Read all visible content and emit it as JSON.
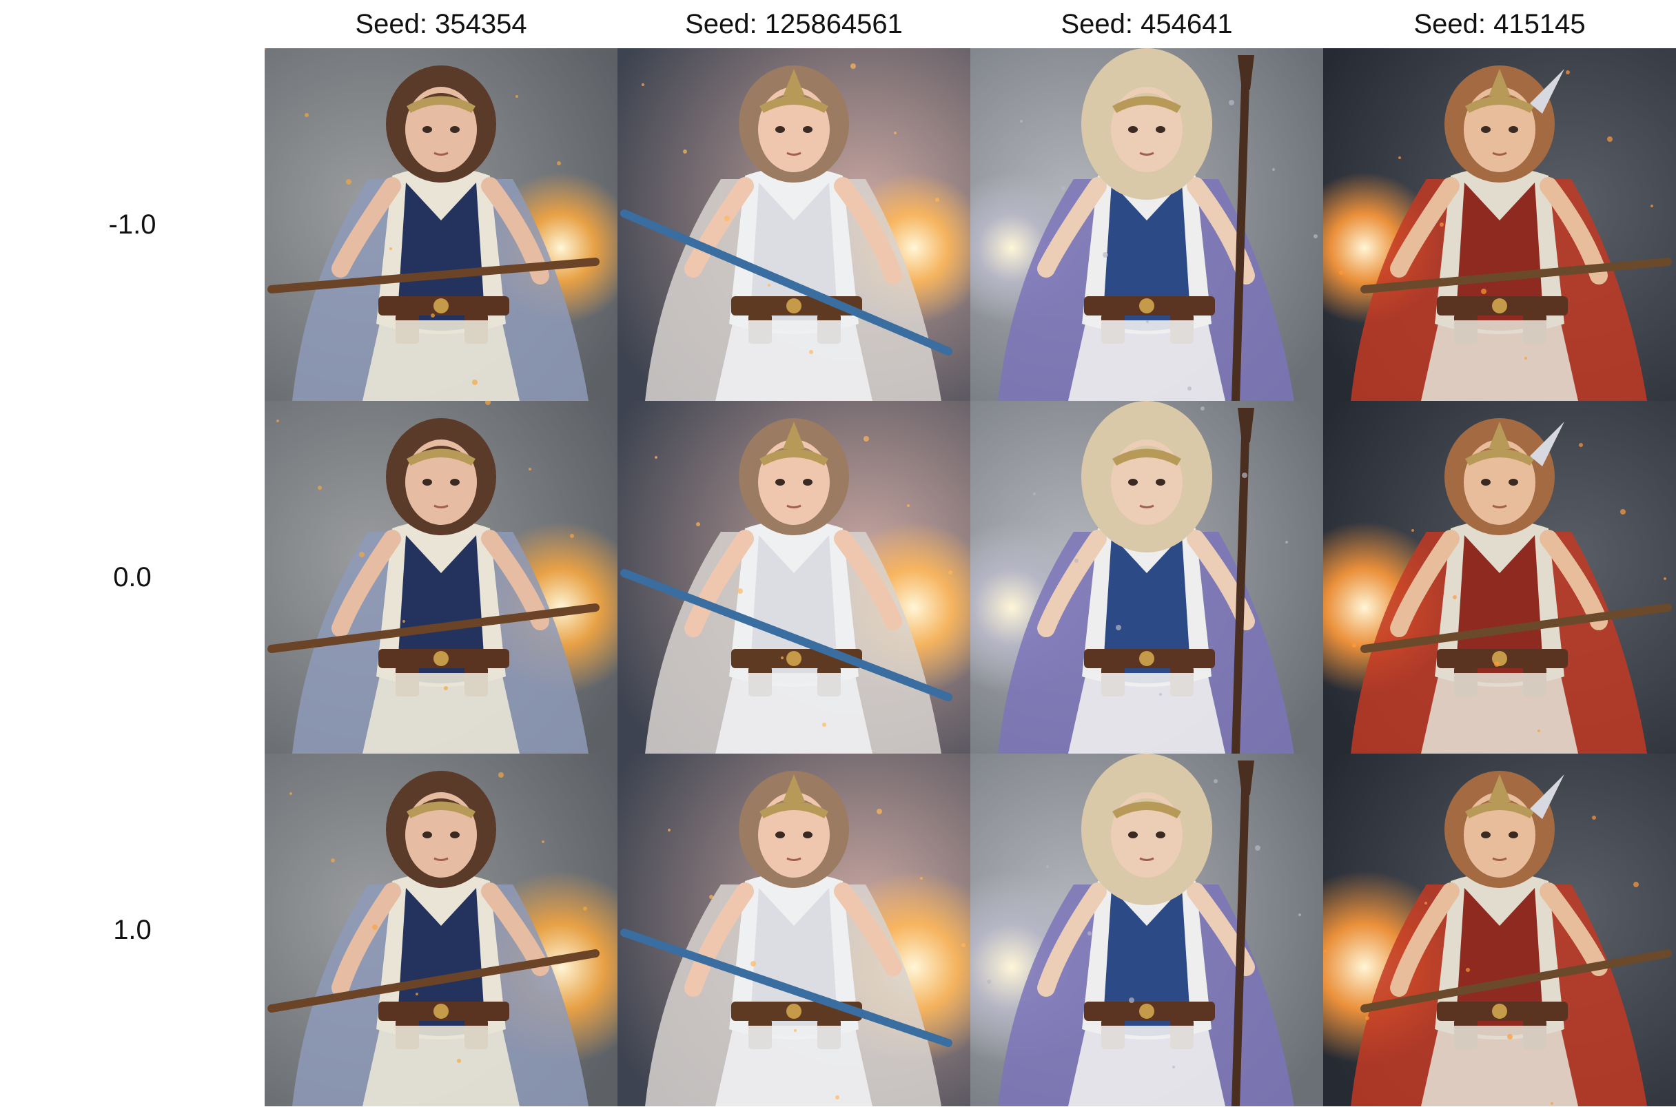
{
  "columns": [
    {
      "label": "Seed: 354354"
    },
    {
      "label": "Seed: 125864561"
    },
    {
      "label": "Seed: 454641"
    },
    {
      "label": "Seed: 415145"
    }
  ],
  "rows": [
    {
      "label": "-1.0"
    },
    {
      "label": "0.0"
    },
    {
      "label": "1.0"
    }
  ],
  "palette": {
    "seed_354354": {
      "bg": "#5d6166",
      "bg2": "#9a9c9e",
      "hair": "#5a3a28",
      "skin": "#e6bda2",
      "top": "#e9e4d6",
      "vest": "#23335e",
      "cape": "#8e9ab8",
      "glow": "#f5a640",
      "belt": "#5a3420",
      "weapon": "#6b4428"
    },
    "seed_125864561": {
      "bg": "#3d4350",
      "bg2": "#c8a6a0",
      "hair": "#9b7b62",
      "skin": "#efc7ae",
      "top": "#eef0f2",
      "vest": "#dcdde2",
      "cape": "#d8d4d0",
      "glow": "#ffb85a",
      "belt": "#5e3a22",
      "weapon": "#3a6da0"
    },
    "seed_454641": {
      "bg": "#6b7076",
      "bg2": "#b3b6bb",
      "hair": "#d9c9a8",
      "skin": "#eccdb6",
      "top": "#eeeeee",
      "vest": "#2b4a86",
      "cape": "#7b74b8",
      "glow": "#b8b8c8",
      "belt": "#5b3521",
      "weapon": "#4a2e20"
    },
    "seed_415145": {
      "bg": "#262a33",
      "bg2": "#5a5e66",
      "hair": "#a46b42",
      "skin": "#e8bd9c",
      "top": "#e2dccf",
      "vest": "#8e2a20",
      "cape": "#c23a25",
      "glow": "#ff9a3a",
      "belt": "#5a3420",
      "weapon": "#6a4a2a"
    }
  }
}
